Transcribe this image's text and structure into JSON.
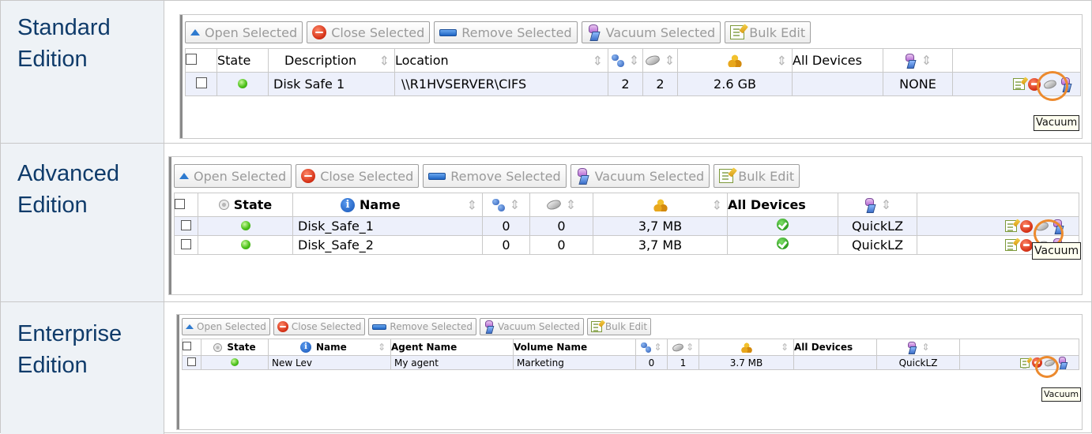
{
  "editions": [
    {
      "label_line1": "Standard",
      "label_line2": "Edition",
      "toolbar": {
        "open": "Open Selected",
        "close": "Close Selected",
        "remove": "Remove Selected",
        "vacuum": "Vacuum Selected",
        "bulk": "Bulk Edit"
      },
      "headers": {
        "state": "State",
        "description": "Description",
        "location": "Location",
        "all_devices": "All Devices"
      },
      "rows": [
        {
          "description": "Disk Safe 1",
          "location": "\\\\R1HVSERVER\\CIFS",
          "agents": "2",
          "disks": "2",
          "size": "2.6 GB",
          "compression": "NONE"
        }
      ],
      "tooltip": "Vacuum"
    },
    {
      "label_line1": "Advanced",
      "label_line2": "Edition",
      "toolbar": {
        "open": "Open Selected",
        "close": "Close Selected",
        "remove": "Remove Selected",
        "vacuum": "Vacuum Selected",
        "bulk": "Bulk Edit"
      },
      "headers": {
        "state": "State",
        "name": "Name",
        "all_devices": "All Devices"
      },
      "rows": [
        {
          "name": "Disk_Safe_1",
          "agents": "0",
          "disks": "0",
          "size": "3,7 MB",
          "compression": "QuickLZ"
        },
        {
          "name": "Disk_Safe_2",
          "agents": "0",
          "disks": "0",
          "size": "3,7 MB",
          "compression": "QuickLZ"
        }
      ],
      "tooltip": "Vacuum"
    },
    {
      "label_line1": "Enterprise",
      "label_line2": "Edition",
      "toolbar": {
        "open": "Open Selected",
        "close": "Close Selected",
        "remove": "Remove Selected",
        "vacuum": "Vacuum Selected",
        "bulk": "Bulk Edit"
      },
      "headers": {
        "state": "State",
        "name": "Name",
        "agent_name": "Agent Name",
        "volume_name": "Volume Name",
        "all_devices": "All Devices"
      },
      "rows": [
        {
          "name": "New Lev",
          "agent_name": "My agent",
          "volume_name": "Marketing",
          "agents": "0",
          "disks": "1",
          "size": "3.7 MB",
          "compression": "QuickLZ"
        }
      ],
      "tooltip": "Vacuum"
    }
  ],
  "colors": {
    "label_text": "#0f3b6a",
    "label_bg": "#eef2f6",
    "highlight_ring": "#ec8a2e",
    "row_selected_bg": "#edf0fb",
    "toolbar_text_disabled": "#9a9a9a"
  },
  "icons": [
    "up-arrow-icon",
    "stop-icon",
    "remove-icon",
    "vacuum-icon",
    "edit-icon",
    "agents-icon",
    "disk-icon",
    "size-icon",
    "status-ok-icon",
    "check-icon",
    "info-icon"
  ]
}
